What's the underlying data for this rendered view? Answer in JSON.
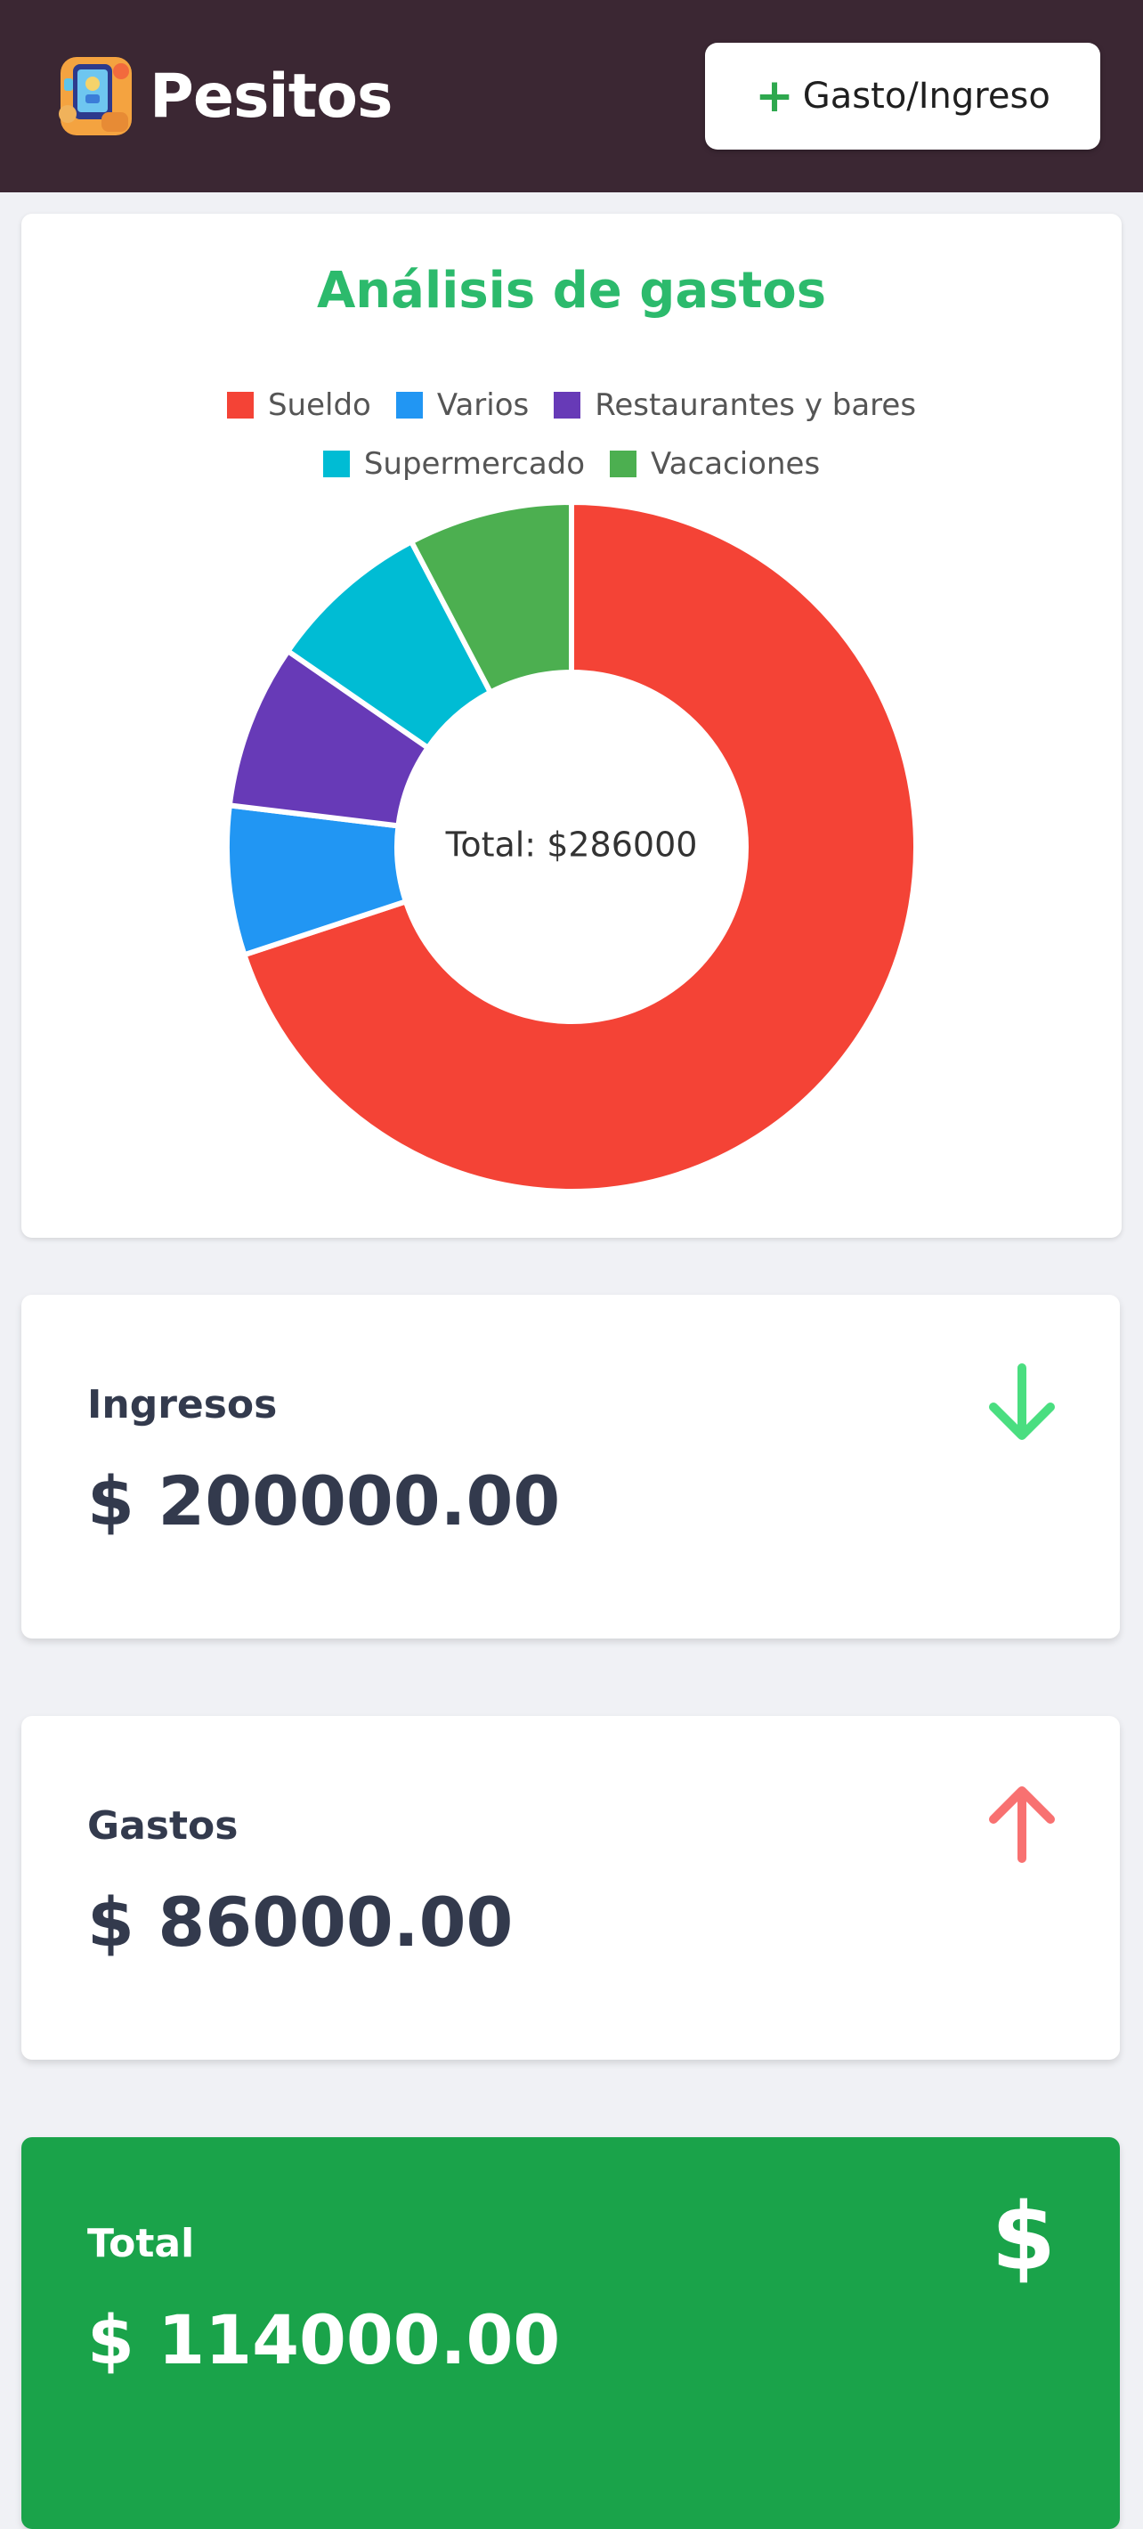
{
  "header": {
    "title": "Pesitos",
    "add_button": {
      "icon": "plus-icon",
      "label": "Gasto/Ingreso"
    },
    "colors": {
      "background": "#3b2733",
      "plus": "#2ea84e"
    }
  },
  "analysis": {
    "title": "Análisis de gastos",
    "center_label": "Total: $286000",
    "legend_rows": [
      [
        "Sueldo",
        "Varios",
        "Restaurantes y bares"
      ],
      [
        "Supermercado",
        "Vacaciones"
      ]
    ]
  },
  "chart_data": {
    "type": "pie",
    "title": "Análisis de gastos",
    "categories": [
      "Sueldo",
      "Varios",
      "Restaurantes y bares",
      "Supermercado",
      "Vacaciones"
    ],
    "values": [
      200000,
      20000,
      22000,
      22000,
      22000
    ],
    "colors": [
      "#f44336",
      "#2196f3",
      "#673ab7",
      "#00bcd4",
      "#4caf50"
    ],
    "donut": true,
    "center_text": "Total: $286000",
    "legend_position": "top"
  },
  "stats": {
    "ingresos": {
      "label": "Ingresos",
      "value": "$ 200000.00",
      "icon": "arrow-down-icon",
      "icon_color": "#4ade80"
    },
    "gastos": {
      "label": "Gastos",
      "value": "$ 86000.00",
      "icon": "arrow-up-icon",
      "icon_color": "#f87171"
    },
    "total": {
      "label": "Total",
      "value": "$ 114000.00",
      "icon": "dollar-icon",
      "icon_glyph": "$",
      "background": "#1aa34a"
    }
  }
}
